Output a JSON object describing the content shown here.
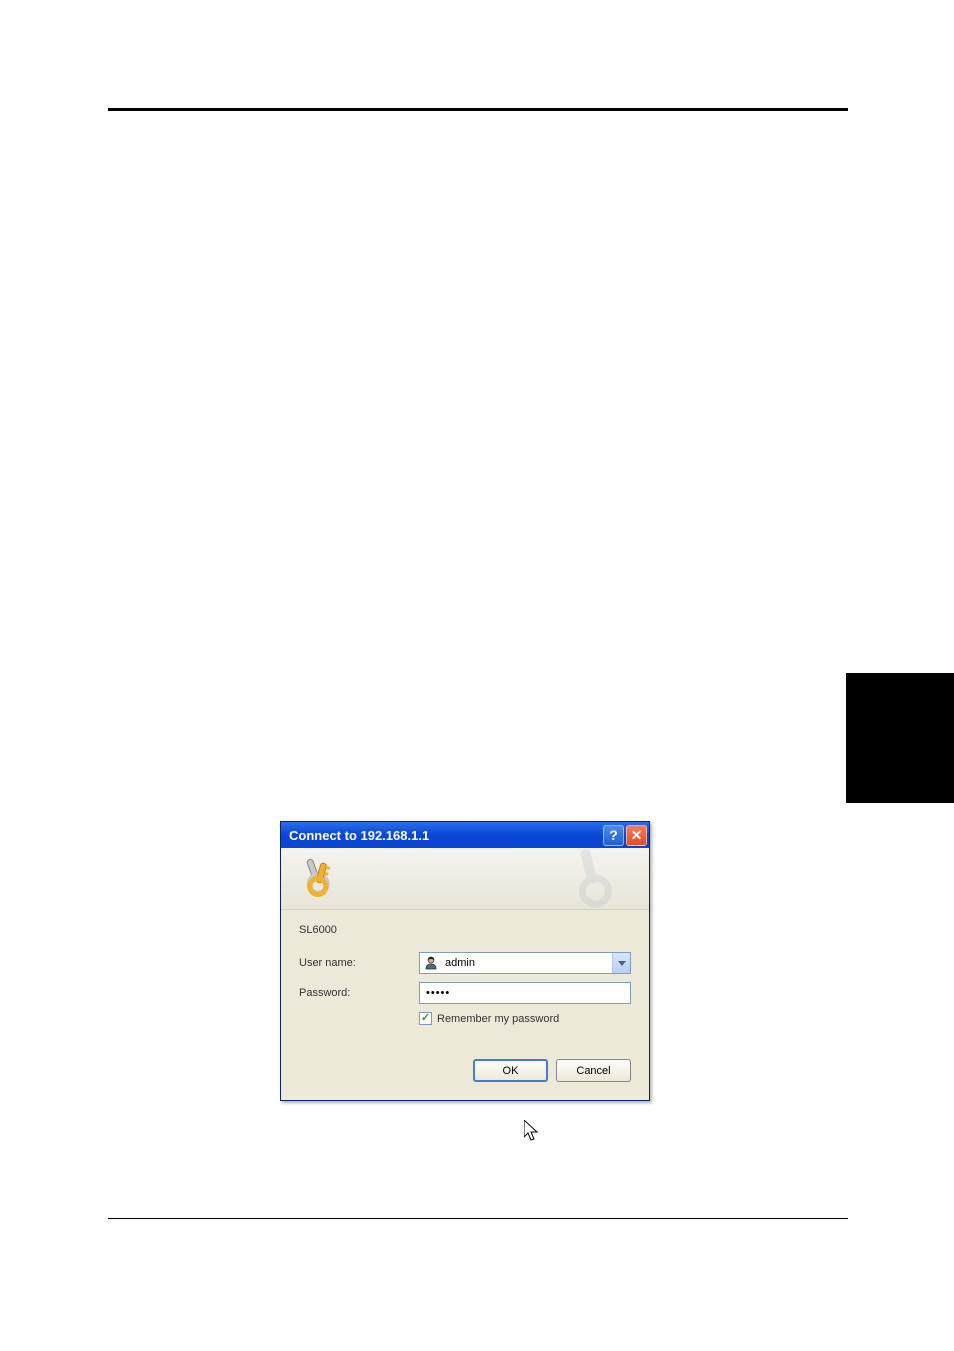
{
  "dialog": {
    "title": "Connect to 192.168.1.1",
    "help_symbol": "?",
    "close_symbol": "✕",
    "realm": "SL6000",
    "username_label": "User name:",
    "username_value": "admin",
    "password_label": "Password:",
    "password_value": "•••••",
    "remember_label": "Remember my password",
    "remember_checked": true,
    "ok_label": "OK",
    "cancel_label": "Cancel"
  }
}
